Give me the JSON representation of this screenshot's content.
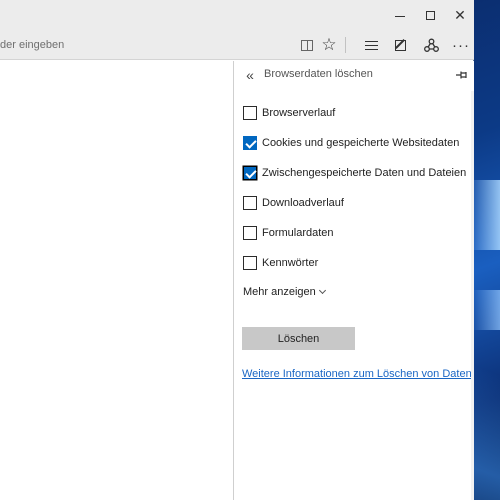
{
  "address_bar": {
    "placeholder": "der eingeben"
  },
  "toolbar": {
    "icons": [
      "reading-view-icon",
      "favorite-star-icon",
      "hub-icon",
      "web-note-icon",
      "share-icon",
      "more-icon"
    ],
    "more_label": "···",
    "star_glyph": "☆"
  },
  "window_controls": {
    "close_glyph": "✕"
  },
  "pane": {
    "back_glyph": "«",
    "title": "Browserdaten löschen",
    "pin_glyph": "⊣",
    "options": [
      {
        "label": "Browserverlauf",
        "checked": false
      },
      {
        "label": "Cookies und gespeicherte Websitedaten",
        "checked": true
      },
      {
        "label": "Zwischengespeicherte Daten und Dateien",
        "checked": true
      },
      {
        "label": "Downloadverlauf",
        "checked": false
      },
      {
        "label": "Formulardaten",
        "checked": false
      },
      {
        "label": "Kennwörter",
        "checked": false
      }
    ],
    "more_label": "Mehr anzeigen",
    "delete_label": "Löschen",
    "info_link": "Weitere Informationen zum Löschen von Daten"
  },
  "colors": {
    "accent": "#0067c0",
    "link": "#1a66c4",
    "button_bg": "#c8c8c8"
  }
}
